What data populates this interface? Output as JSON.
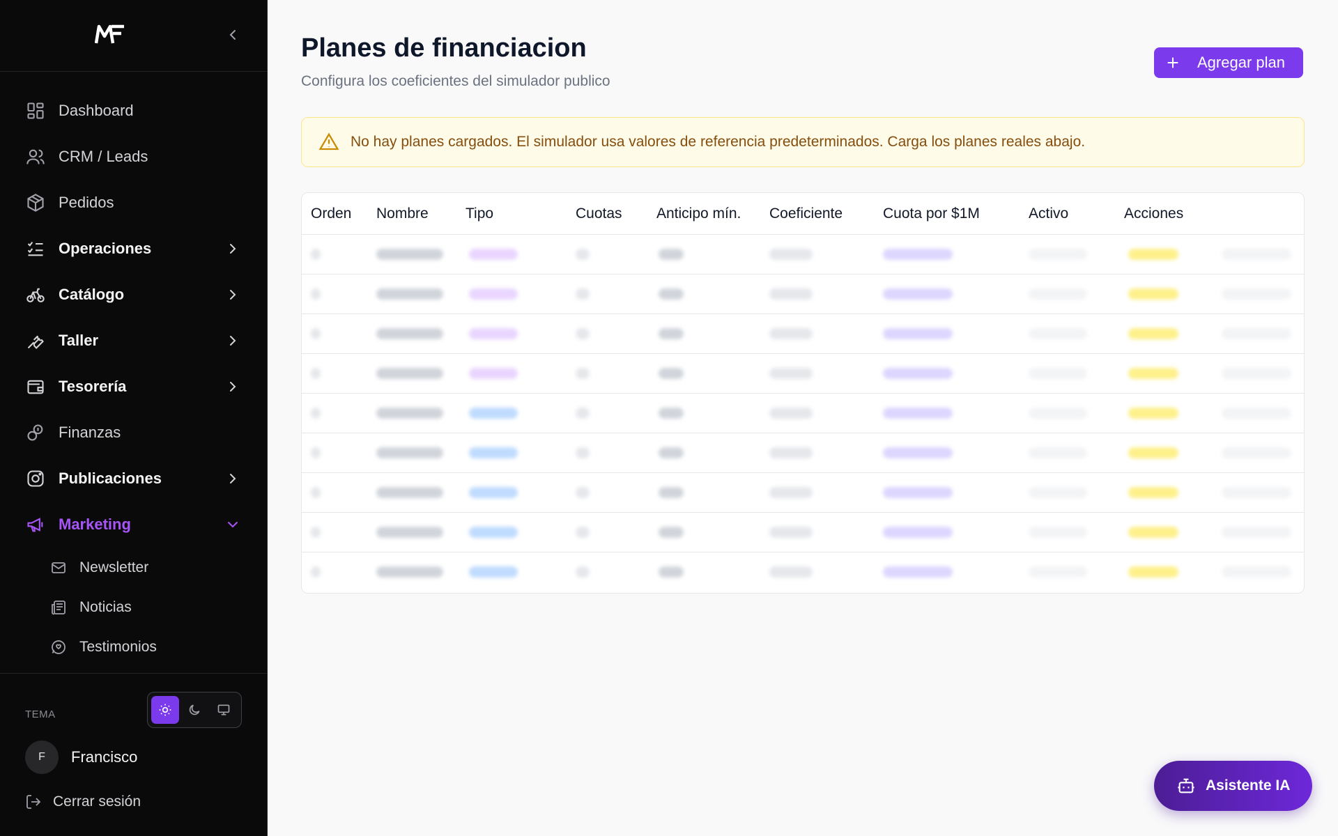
{
  "sidebar": {
    "brand": "MF",
    "items": [
      {
        "label": "Dashboard",
        "icon": "dashboard-icon"
      },
      {
        "label": "CRM / Leads",
        "icon": "users-icon"
      },
      {
        "label": "Pedidos",
        "icon": "package-icon"
      },
      {
        "label": "Operaciones",
        "icon": "list-checks-icon",
        "expandable": true
      },
      {
        "label": "Catálogo",
        "icon": "bike-icon",
        "expandable": true
      },
      {
        "label": "Taller",
        "icon": "wrench-icon",
        "expandable": true
      },
      {
        "label": "Tesorería",
        "icon": "wallet-icon",
        "expandable": true
      },
      {
        "label": "Finanzas",
        "icon": "coins-icon"
      },
      {
        "label": "Publicaciones",
        "icon": "instagram-icon",
        "expandable": true
      },
      {
        "label": "Marketing",
        "icon": "megaphone-icon",
        "expandable": true,
        "expanded": true
      }
    ],
    "sub_items": [
      {
        "label": "Newsletter",
        "icon": "mail-icon"
      },
      {
        "label": "Noticias",
        "icon": "newspaper-icon"
      },
      {
        "label": "Testimonios",
        "icon": "message-circle-icon"
      }
    ],
    "theme_label": "TEMA",
    "theme_options": [
      "light",
      "dark",
      "system"
    ],
    "theme_selected": "light",
    "user_initial": "F",
    "user_name": "Francisco",
    "logout_label": "Cerrar sesión"
  },
  "main": {
    "title": "Planes de financiacion",
    "subtitle": "Configura los coeficientes del simulador publico",
    "add_button": "Agregar plan",
    "alert_text": "No hay planes cargados. El simulador usa valores de referencia predeterminados. Carga los planes reales abajo.",
    "table": {
      "headers": [
        "Orden",
        "Nombre",
        "Tipo",
        "Cuotas",
        "Anticipo mín.",
        "Coeficiente",
        "Cuota por $1M",
        "Activo",
        "Acciones"
      ]
    }
  },
  "ai_button": "Asistente IA",
  "colors": {
    "accent": "#7c3aed",
    "active_nav": "#a855f7",
    "alert_bg": "#fefce8",
    "alert_text": "#854d0e"
  }
}
